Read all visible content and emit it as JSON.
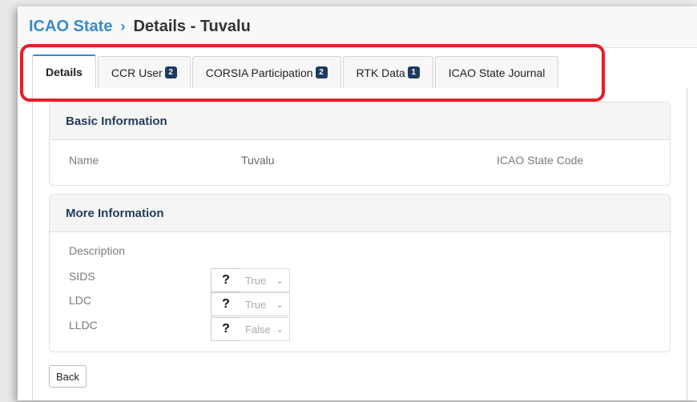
{
  "breadcrumb": {
    "parent": "ICAO State",
    "separator": "›",
    "current": "Details - Tuvalu"
  },
  "tabs": [
    {
      "label": "Details",
      "active": true
    },
    {
      "label": "CCR User",
      "badge": "2"
    },
    {
      "label": "CORSIA Participation",
      "badge": "2"
    },
    {
      "label": "RTK Data",
      "badge": "1"
    },
    {
      "label": "ICAO State Journal"
    }
  ],
  "basic_info": {
    "title": "Basic Information",
    "name_label": "Name",
    "name_value": "Tuvalu",
    "code_label": "ICAO State Code"
  },
  "more_info": {
    "title": "More Information",
    "description_label": "Description",
    "flags": [
      {
        "label": "SIDS",
        "help": "?",
        "value": "True"
      },
      {
        "label": "LDC",
        "help": "?",
        "value": "True"
      },
      {
        "label": "LLDC",
        "help": "?",
        "value": "False"
      }
    ]
  },
  "actions": {
    "back_label": "Back"
  },
  "colors": {
    "accent": "#3a8bc9",
    "badge": "#1e3a5f",
    "highlight": "#e41e26"
  }
}
